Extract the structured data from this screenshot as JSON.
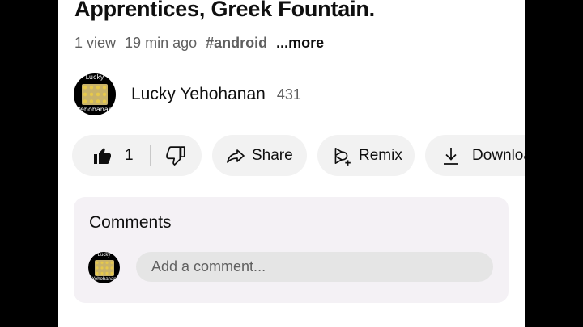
{
  "video": {
    "title": "Apprentices, Greek Fountain.",
    "views": "1 view",
    "age": "19 min ago",
    "hashtag": "#android",
    "more": "...more"
  },
  "channel": {
    "name": "Lucky Yehohanan",
    "subscribers": "431",
    "avatar_caption_top": "Lucky",
    "avatar_caption_bottom": "Yehohanan"
  },
  "actions": {
    "like_count": "1",
    "share_label": "Share",
    "remix_label": "Remix",
    "download_label": "Download"
  },
  "comments": {
    "heading": "Comments",
    "placeholder": "Add a comment..."
  },
  "icons": {
    "like": "thumbs-up-icon",
    "dislike": "thumbs-down-icon",
    "share": "share-arrow-icon",
    "remix": "remix-icon",
    "download": "download-icon"
  },
  "colors": {
    "pill_bg": "#f2f2f2",
    "comments_bg": "#f4f1f5",
    "text_primary": "#0f0f0f",
    "text_secondary": "#606060"
  }
}
